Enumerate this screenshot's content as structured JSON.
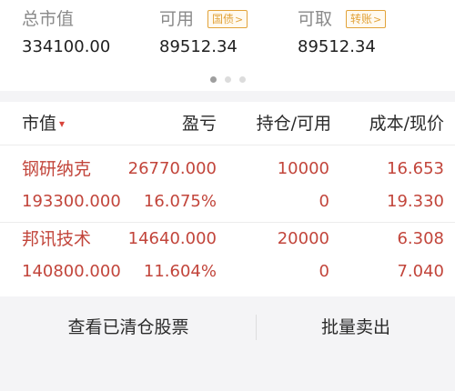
{
  "summary": {
    "total_assets_label": "总市值",
    "total_assets_value": "334100.00",
    "available_label": "可用",
    "available_tag": "国债",
    "available_value": "89512.34",
    "withdrawable_label": "可取",
    "withdrawable_tag": "转账",
    "withdrawable_value": "89512.34",
    "chevron": ">"
  },
  "pager": {
    "count": 3,
    "active_index": 0
  },
  "table": {
    "headers": {
      "market_value": "市值",
      "profit_loss": "盈亏",
      "position": "持仓/可用",
      "cost_price": "成本/现价"
    },
    "sort_caret": "▾",
    "rows": [
      {
        "name": "钢研纳克",
        "market_value": "193300.000",
        "profit_loss": "26770.000",
        "profit_loss_ratio": "16.075%",
        "position": "10000",
        "available": "0",
        "cost": "16.653",
        "price": "19.330"
      },
      {
        "name": "邦讯技术",
        "market_value": "140800.000",
        "profit_loss": "14640.000",
        "profit_loss_ratio": "11.604%",
        "position": "20000",
        "available": "0",
        "cost": "6.308",
        "price": "7.040"
      }
    ]
  },
  "actions": {
    "view_cleared": "查看已清仓股票",
    "batch_sell": "批量卖出"
  },
  "colors": {
    "accent": "#e2a33a",
    "gain": "#c2453b"
  }
}
